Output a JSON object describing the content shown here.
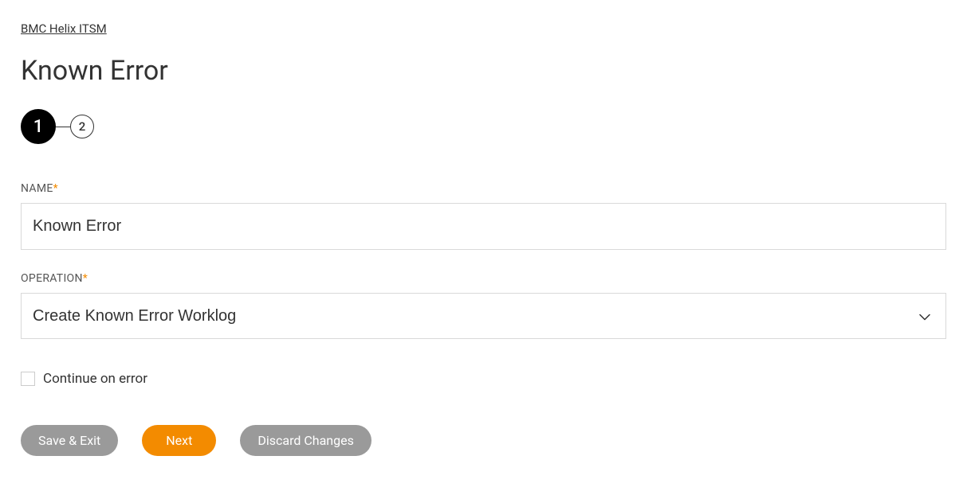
{
  "breadcrumb": {
    "label": "BMC Helix ITSM"
  },
  "page": {
    "title": "Known Error"
  },
  "stepper": {
    "steps": [
      "1",
      "2"
    ],
    "active_index": 0
  },
  "form": {
    "name_label": "NAME",
    "name_value": "Known Error",
    "operation_label": "OPERATION",
    "operation_value": "Create Known Error Worklog",
    "continue_on_error_label": "Continue on error",
    "continue_on_error_checked": false
  },
  "buttons": {
    "save_exit": "Save & Exit",
    "next": "Next",
    "discard": "Discard Changes"
  }
}
